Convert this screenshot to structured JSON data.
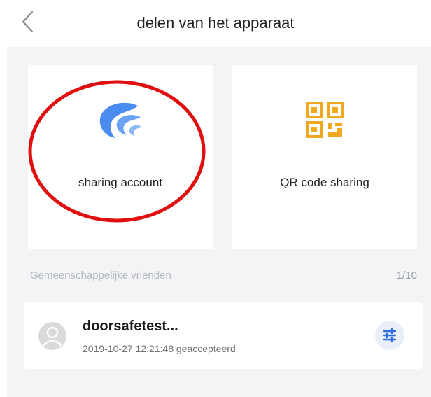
{
  "header": {
    "title": "delen van het apparaat",
    "back_icon": "chevron-left-icon"
  },
  "sharing": {
    "options": [
      {
        "label": "sharing account",
        "icon": "logo-wing-icon",
        "icon_color": "#4a8cf0"
      },
      {
        "label": "QR code sharing",
        "icon": "qr-code-icon",
        "icon_color": "#f2a81e"
      }
    ]
  },
  "friends": {
    "section_label": "Gemeenschappelijke vrienden",
    "count": "1/10",
    "items": [
      {
        "name": "doorsafetest...",
        "status": "2019-10-27 12:21:48 geaccepteerd",
        "action_icon": "settings-sliders-icon"
      }
    ]
  },
  "colors": {
    "page_background": "#f3f4f6",
    "accent_blue": "#2f6fe0",
    "highlight_red": "#e01010"
  }
}
